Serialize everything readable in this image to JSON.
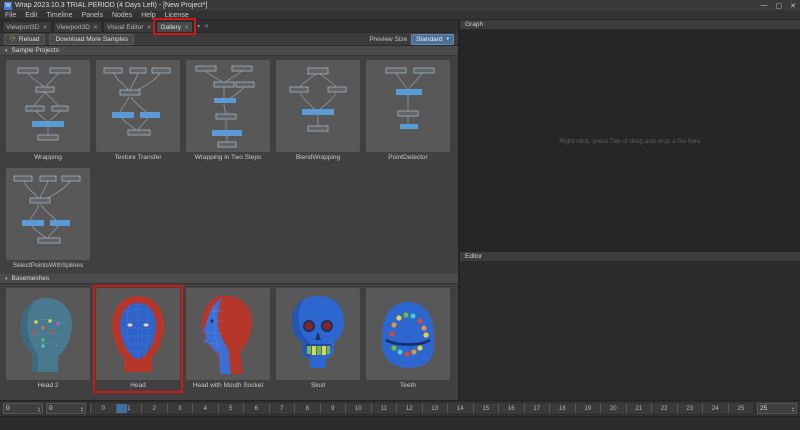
{
  "window": {
    "title": "Wrap 2023.10.3 TRIAL PERIOD (4 Days Left) - [New Project*]",
    "app_initial": "W"
  },
  "icons": {
    "minimize": "—",
    "maximize": "▢",
    "close": "✕",
    "tab_close": "✕",
    "undock": "▾",
    "panel_close": "✕",
    "reload": "⟳",
    "dropdown": "▾",
    "section_collapse": "▾",
    "spin_up": "▴",
    "spin_down": "▾"
  },
  "menu": {
    "items": [
      "File",
      "Edit",
      "Timeline",
      "Panels",
      "Nodes",
      "Help",
      "License"
    ]
  },
  "tabs": [
    {
      "label": "Viewport3D"
    },
    {
      "label": "Viewport3D"
    },
    {
      "label": "Visual Editor"
    },
    {
      "label": "Gallery"
    }
  ],
  "toolbar": {
    "reload": "Reload",
    "download": "Download More Samples",
    "preview_size_label": "Preview Size",
    "preview_size_value": "Standard"
  },
  "gallery": {
    "sections": [
      {
        "title": "Sample Projects",
        "items": [
          "Wrapping",
          "Texture Transfer",
          "Wrapping in Two Steps",
          "BlendWrapping",
          "PointDetector",
          "SelectPointsWithSplines"
        ]
      },
      {
        "title": "Basemeshes",
        "items": [
          "Head 2",
          "Head",
          "Head with Mouth Socket",
          "Skull",
          "Teeth"
        ]
      }
    ]
  },
  "graph_panel": {
    "title": "Graph",
    "hint": "Right click, press Tab or drag and drop a file here"
  },
  "editor_panel": {
    "title": "Editor"
  },
  "timeline": {
    "current_value": "0",
    "start_value": "0",
    "end_value": "25",
    "current_frame": 1,
    "ticks": [
      0,
      1,
      2,
      3,
      4,
      5,
      6,
      7,
      8,
      9,
      10,
      11,
      12,
      13,
      14,
      15,
      16,
      17,
      18,
      19,
      20,
      21,
      22,
      23,
      24,
      25
    ]
  },
  "annotations": {
    "color": "#d01818"
  }
}
